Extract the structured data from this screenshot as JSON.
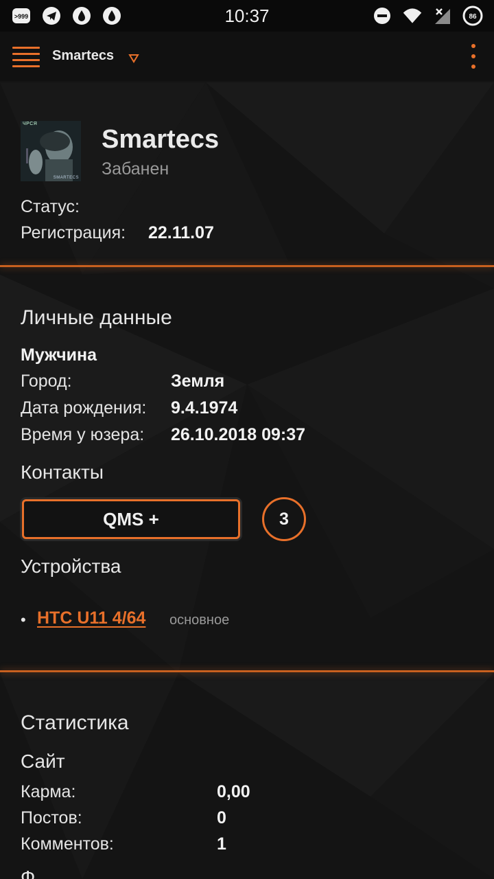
{
  "status_bar": {
    "time": "10:37",
    "left_icons": [
      "notification-count-icon",
      "telegram-icon",
      "droplet-icon",
      "droplet-icon"
    ],
    "notification_count": ">999",
    "right_icons": [
      "do-not-disturb-icon",
      "wifi-icon",
      "signal-icon",
      "battery-icon"
    ],
    "battery_level": "86"
  },
  "app_bar": {
    "title": "Smartecs"
  },
  "profile": {
    "avatar_tag": "ЧРСЯ",
    "avatar_brand": "SMARTECS",
    "name": "Smartecs",
    "status": "Забанен",
    "status_label": "Статус:",
    "registration_label": "Регистрация:",
    "registration_value": "22.11.07"
  },
  "personal": {
    "title": "Личные данные",
    "gender": "Мужчина",
    "city_label": "Город:",
    "city_value": "Земля",
    "birthdate_label": "Дата рождения:",
    "birthdate_value": "9.4.1974",
    "usertime_label": "Время у юзера:",
    "usertime_value": "26.10.2018 09:37"
  },
  "contacts": {
    "title": "Контакты",
    "qms_label": "QMS +",
    "qms_count": "3"
  },
  "devices": {
    "title": "Устройства",
    "items": [
      {
        "name": "HTC U11 4/64",
        "tag": "основное"
      }
    ]
  },
  "statistics": {
    "title": "Статистика",
    "site_title": "Сайт",
    "karma_label": "Карма:",
    "karma_value": "0,00",
    "posts_label": "Постов:",
    "posts_value": "0",
    "comments_label": "Комментов:",
    "comments_value": "1",
    "next_title": "Ф"
  },
  "colors": {
    "accent": "#e8702a",
    "background": "#141414",
    "text": "#e6e6e6",
    "muted": "#9a9a9a"
  }
}
